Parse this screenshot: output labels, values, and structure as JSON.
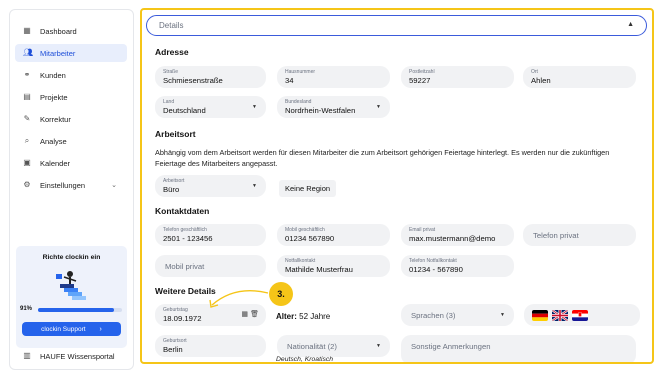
{
  "sidebar": {
    "items": [
      {
        "label": "Dashboard",
        "icon": "dashboard-icon"
      },
      {
        "label": "Mitarbeiter",
        "icon": "users-icon",
        "active": true
      },
      {
        "label": "Kunden",
        "icon": "handshake-icon"
      },
      {
        "label": "Projekte",
        "icon": "clipboard-icon"
      },
      {
        "label": "Korrektur",
        "icon": "edit-icon"
      },
      {
        "label": "Analyse",
        "icon": "magnifier-icon"
      },
      {
        "label": "Kalender",
        "icon": "calendar-icon"
      },
      {
        "label": "Einstellungen",
        "icon": "gear-icon"
      }
    ],
    "promo": {
      "title": "Richte clockin ein",
      "percent": "91%",
      "progress": 0.91,
      "button": "clockin Support"
    },
    "portal": "HAUFE Wissensportal"
  },
  "main": {
    "details": "Details",
    "adresse": {
      "title": "Adresse",
      "strasse": {
        "label": "Straße",
        "value": "Schmiesenstraße"
      },
      "hausnummer": {
        "label": "Hausnummer",
        "value": "34"
      },
      "postleitzahl": {
        "label": "Postleitzahl",
        "value": "59227"
      },
      "ort": {
        "label": "Ort",
        "value": "Ahlen"
      },
      "land": {
        "label": "Land",
        "value": "Deutschland"
      },
      "bundesland": {
        "label": "Bundesland",
        "value": "Nordrhein-Westfalen"
      }
    },
    "arbeitsort": {
      "title": "Arbeitsort",
      "info": "Abhängig vom dem Arbeitsort werden für diesen Mitarbeiter die zum Arbeitsort gehörigen Feiertage hinterlegt. Es werden nur die zukünftigen Feiertage des Mitarbeiters angepasst.",
      "field": {
        "label": "Arbeitsort",
        "value": "Büro"
      },
      "region": "Keine Region"
    },
    "kontakt": {
      "title": "Kontaktdaten",
      "tel_g": {
        "label": "Telefon geschäftlich",
        "value": "2501 - 123456"
      },
      "mobil_g": {
        "label": "Mobil geschäftlich",
        "value": "01234 567890"
      },
      "email": {
        "label": "Email privat",
        "value": "max.mustermann@demo"
      },
      "tel_p": {
        "placeholder": "Telefon privat"
      },
      "mobil_p": {
        "placeholder": "Mobil privat"
      },
      "notfall": {
        "label": "Notfallkontakt",
        "value": "Mathilde Musterfrau"
      },
      "notfall_tel": {
        "label": "Telefon Notfallkontakt",
        "value": "01234 - 567890"
      }
    },
    "weitere": {
      "title": "Weitere Details",
      "geburtstag": {
        "label": "Geburtstag",
        "value": "18.09.1972"
      },
      "alter_label": "Alter:",
      "alter_value": "52 Jahre",
      "sprachen": "Sprachen (3)",
      "geburtsort": {
        "label": "Geburtsort",
        "value": "Berlin"
      },
      "nationalitaet": "Nationalität (2)",
      "nationalitaet_sub": "Deutsch, Kroatisch",
      "anmerkungen": "Sonstige Anmerkungen",
      "flags": [
        "flag-germany-icon",
        "flag-uk-icon",
        "flag-croatia-icon"
      ]
    },
    "callout": "3."
  },
  "colors": {
    "accent": "#2563eb",
    "highlight": "#f5c518",
    "field": "#f1f2f4"
  }
}
